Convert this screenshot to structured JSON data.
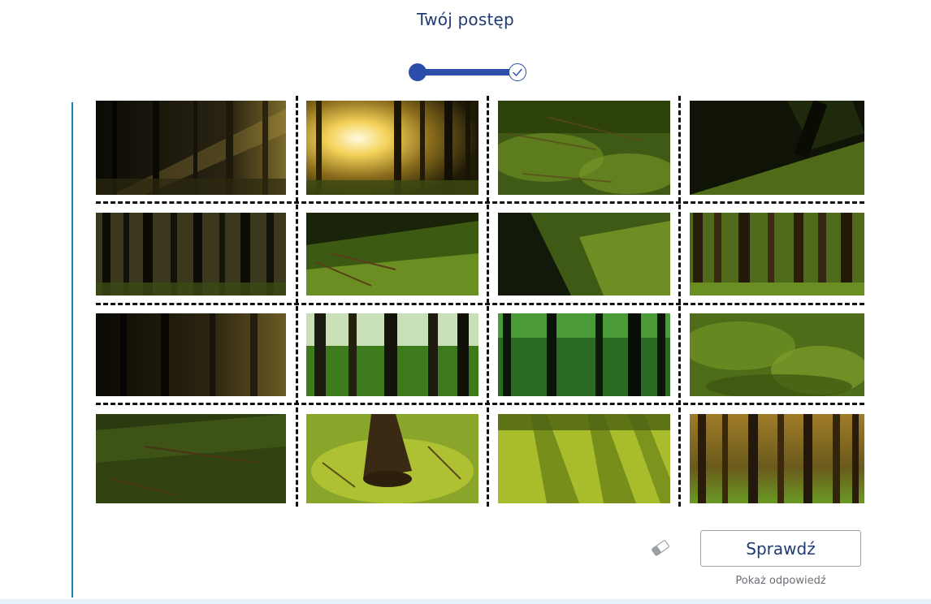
{
  "progress": {
    "title": "Twój postęp",
    "fraction": 1.0
  },
  "tiles": [
    {
      "id": "tile-1"
    },
    {
      "id": "tile-2"
    },
    {
      "id": "tile-3"
    },
    {
      "id": "tile-4"
    },
    {
      "id": "tile-5"
    },
    {
      "id": "tile-6"
    },
    {
      "id": "tile-7"
    },
    {
      "id": "tile-8"
    },
    {
      "id": "tile-9"
    },
    {
      "id": "tile-10"
    },
    {
      "id": "tile-11"
    },
    {
      "id": "tile-12"
    },
    {
      "id": "tile-13"
    },
    {
      "id": "tile-14"
    },
    {
      "id": "tile-15"
    },
    {
      "id": "tile-16"
    }
  ],
  "actions": {
    "check_label": "Sprawdź",
    "show_answer_label": "Pokaż odpowiedź",
    "reset_icon": "eraser-icon"
  },
  "colors": {
    "accent": "#2b4eaa",
    "title": "#1f3b70",
    "left_rule": "#1f7bb0"
  }
}
